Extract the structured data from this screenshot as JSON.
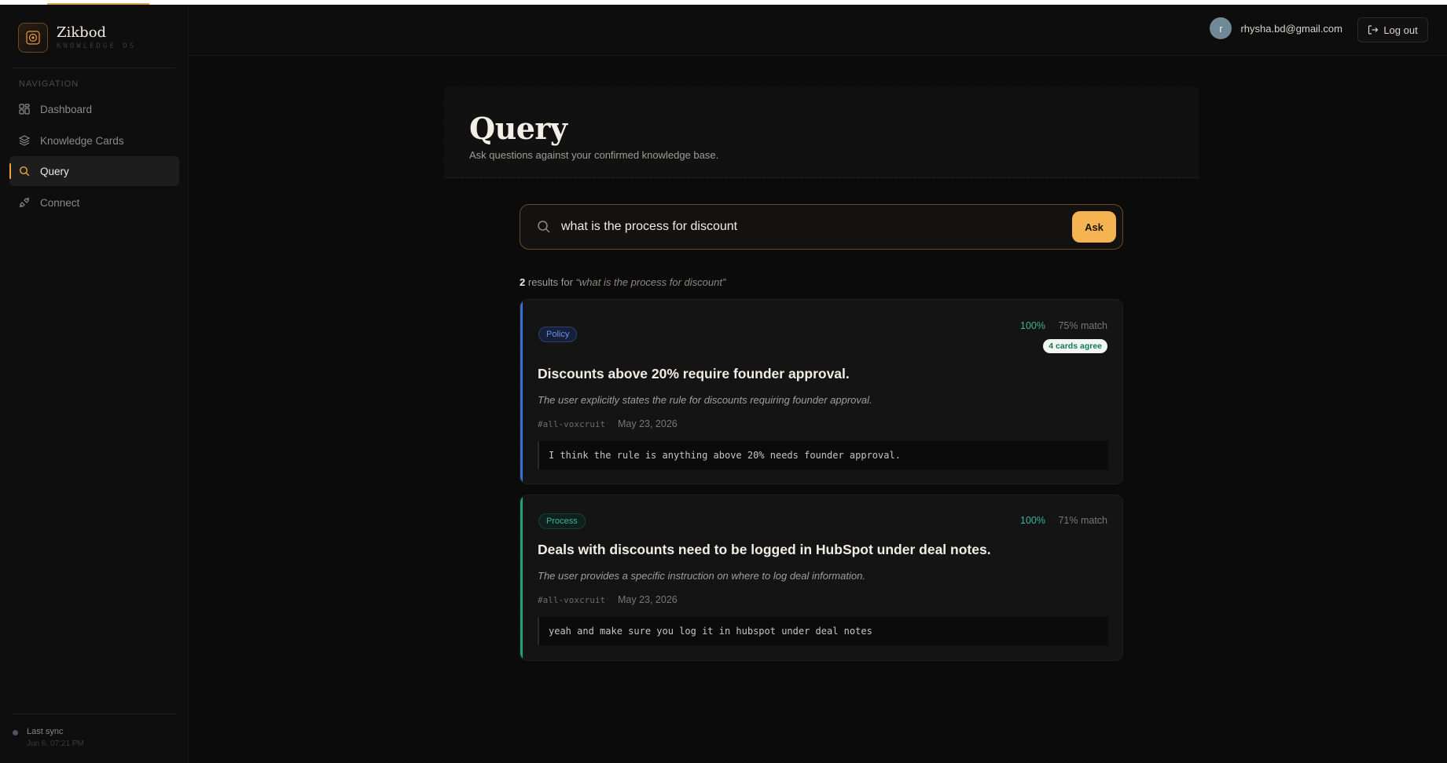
{
  "app": {
    "name": "Zikbod",
    "subtitle": "KNOWLEDGE OS"
  },
  "sidebar": {
    "heading": "NAVIGATION",
    "items": [
      {
        "label": "Dashboard",
        "icon": "grid-icon",
        "active": false
      },
      {
        "label": "Knowledge Cards",
        "icon": "layers-icon",
        "active": false
      },
      {
        "label": "Query",
        "icon": "search-icon",
        "active": true
      },
      {
        "label": "Connect",
        "icon": "plug-icon",
        "active": false
      }
    ],
    "sync_label": "Last sync",
    "sync_time": "Jun 6, 07:21 PM"
  },
  "header": {
    "avatar_letter": "r",
    "email": "rhysha.bd@gmail.com",
    "logout_label": "Log out"
  },
  "page": {
    "title": "Query",
    "subtitle": "Ask questions against your confirmed knowledge base."
  },
  "search": {
    "value": "what is the process for discount",
    "ask_label": "Ask"
  },
  "results": {
    "count": "2",
    "for_label": "results for",
    "query_quoted": "“what is the process for discount”",
    "items": [
      {
        "tag": "Policy",
        "confidence": "100%",
        "match": "75% match",
        "agree": "4 cards agree",
        "title": "Discounts above 20% require founder approval.",
        "reason": "The user explicitly states the rule for discounts requiring founder approval.",
        "channel": "#all-voxcruit",
        "date": "May 23, 2026",
        "quote": "I think the rule is anything above 20% needs founder approval."
      },
      {
        "tag": "Process",
        "confidence": "100%",
        "match": "71% match",
        "title": "Deals with discounts need to be logged in HubSpot under deal notes.",
        "reason": "The user provides a specific instruction on where to log deal information.",
        "channel": "#all-voxcruit",
        "date": "May 23, 2026",
        "quote": "yeah and make sure you log it in hubspot under deal notes"
      }
    ]
  },
  "colors": {
    "accent": "#f4b451",
    "policy": "#3a6fd8",
    "process": "#1fa37a",
    "background": "#0b0b0b"
  }
}
